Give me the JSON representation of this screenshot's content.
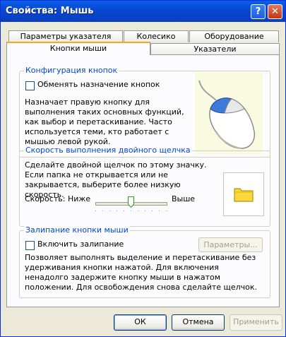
{
  "window": {
    "title": "Свойства: Мышь",
    "help_symbol": "?",
    "close_symbol": "✕"
  },
  "tabs_row1": [
    "Параметры указателя",
    "Колесико",
    "Оборудование"
  ],
  "tabs_row2": [
    "Кнопки мыши",
    "Указатели"
  ],
  "active_tab": "Кнопки мыши",
  "buttons_config": {
    "group_title": "Конфигурация кнопок",
    "checkbox_label": "Обменять назначение кнопок",
    "checked": false,
    "description": "Назначает правую кнопку для выполнения таких основных функций, как выбор и перетаскивание. Часто используется теми, кто работает с мышью левой рукой."
  },
  "double_click": {
    "group_title": "Скорость выполнения двойного щелчка",
    "description": "Сделайте двойной щелчок по этому значку. Если папка не открывается или не закрывается, выберите более низкую скорость.",
    "speed_label": "Скорость:",
    "slower_label": "Ниже",
    "faster_label": "Выше",
    "speed_fraction": 0.5
  },
  "click_lock": {
    "group_title": "Залипание кнопки мыши",
    "checkbox_label": "Включить залипание",
    "checked": false,
    "settings_button": "Параметры...",
    "description": "Позволяет выполнять выделение и перетаскивание без удерживания кнопки нажатой. Для включения ненадолго задержите кнопку мыши в нажатом положении. Для освобождения снова сделайте щелчок."
  },
  "dialog_buttons": {
    "ok": "ОК",
    "cancel": "Отмена",
    "apply": "Применить"
  },
  "colors": {
    "titlebar": "#0a5fe8",
    "accent": "#0046d5",
    "tab_highlight": "#f7a71b",
    "face": "#ece9d8"
  },
  "icons": {
    "mouse": "mouse-illustration-icon",
    "folder": "folder-icon"
  }
}
